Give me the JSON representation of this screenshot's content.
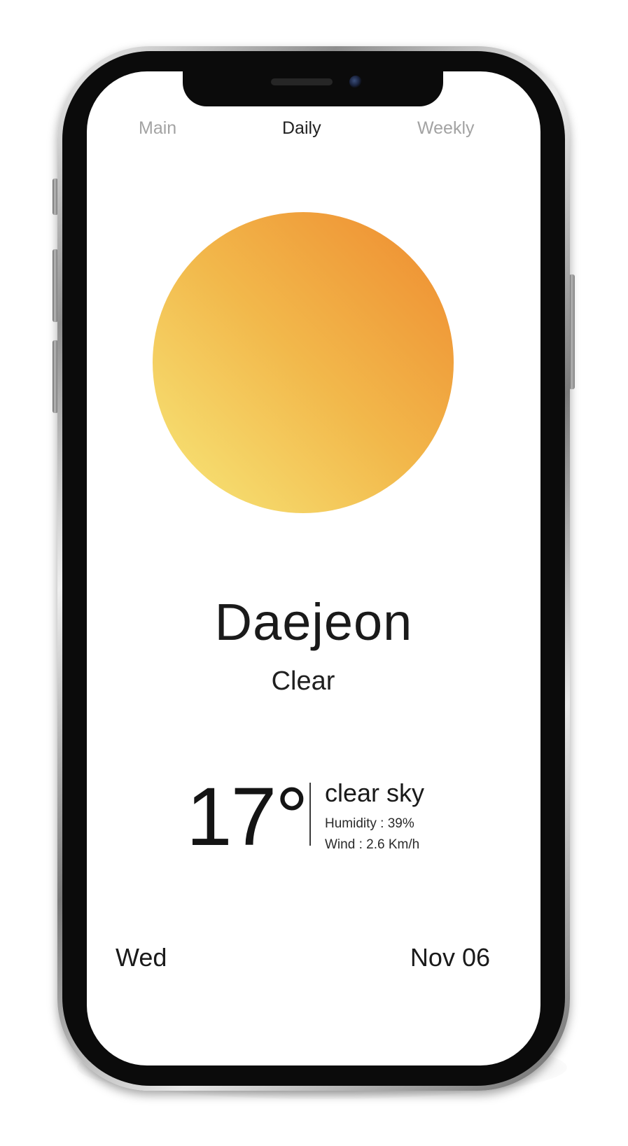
{
  "tabs": {
    "main": "Main",
    "daily": "Daily",
    "weekly": "Weekly",
    "active": "Daily"
  },
  "weather": {
    "city": "Daejeon",
    "condition": "Clear",
    "temperature": "17°",
    "description": "clear sky",
    "humidity": "Humidity : 39%",
    "wind": "Wind : 2.6 Km/h",
    "icon": "sun-icon"
  },
  "footer": {
    "day": "Wed",
    "date": "Nov 06"
  },
  "colors": {
    "sun_light": "#f7e87a",
    "sun_mid": "#f2b84b",
    "sun_dark": "#ee8a2f",
    "active_tab": "#222222",
    "inactive_tab": "#a3a3a3",
    "text": "#1a1a1a"
  }
}
